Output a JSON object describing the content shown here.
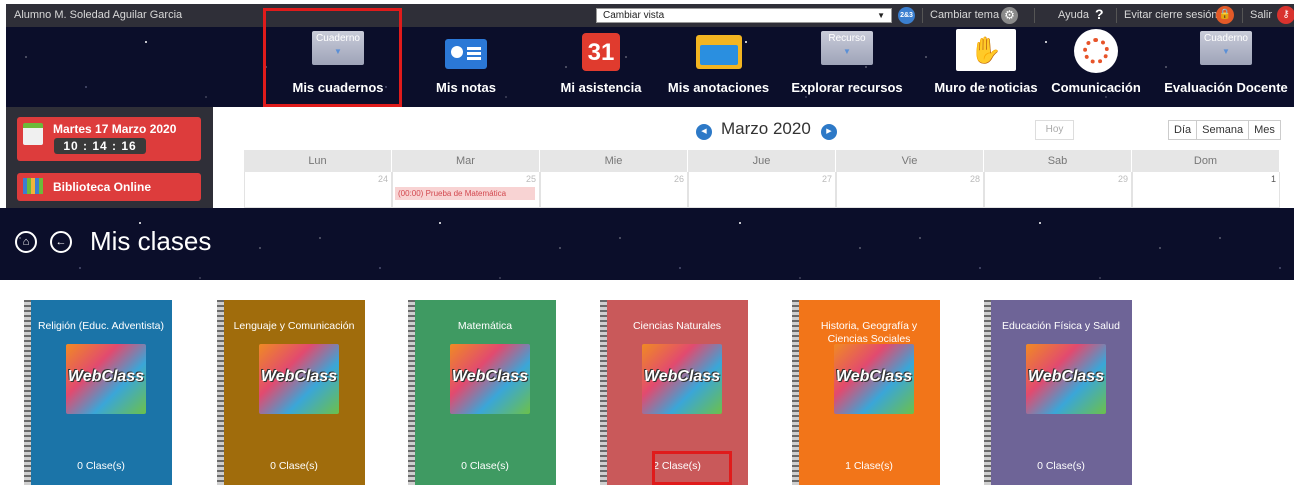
{
  "topbar": {
    "user_name": "Alumno M. Soledad Aguilar Garcia",
    "view_select_value": "Cambiar vista",
    "view_icon_text": "2&3",
    "change_theme": "Cambiar tema",
    "help": "Ayuda",
    "help_mark": "?",
    "avoid_close": "Evitar cierre sesión",
    "exit": "Salir"
  },
  "nav": {
    "items": [
      {
        "label": "Mis cuadernos",
        "icon_text": "Cuaderno"
      },
      {
        "label": "Mis notas"
      },
      {
        "label": "Mi asistencia",
        "icon_text": "31"
      },
      {
        "label": "Mis anotaciones"
      },
      {
        "label": "Explorar recursos",
        "icon_text": "Recurso"
      },
      {
        "label": "Muro de noticias"
      },
      {
        "label": "Comunicación"
      },
      {
        "label": "Evaluación Docente",
        "icon_text": "Cuaderno"
      }
    ]
  },
  "sidebar": {
    "date": "Martes 17 Marzo 2020",
    "time": "10 : 14 : 16",
    "library": "Biblioteca Online"
  },
  "calendar": {
    "title": "Marzo 2020",
    "today": "Hoy",
    "views": [
      "Día",
      "Semana",
      "Mes"
    ],
    "weekdays": [
      "Lun",
      "Mar",
      "Mie",
      "Jue",
      "Vie",
      "Sab",
      "Dom"
    ],
    "days": [
      "24",
      "25",
      "26",
      "27",
      "28",
      "29",
      "1"
    ],
    "event": "(00:00) Prueba de Matemática"
  },
  "clases": {
    "title": "Mis clases",
    "logo_text": "WebClass",
    "cards": [
      {
        "title": "Religión (Educ. Adventista)",
        "count": "0 Clase(s)",
        "color": "#1b74a8"
      },
      {
        "title": "Lenguaje y Comunicación",
        "count": "0 Clase(s)",
        "color": "#a06c0c"
      },
      {
        "title": "Matemática",
        "count": "0 Clase(s)",
        "color": "#3f9a62"
      },
      {
        "title": "Ciencias Naturales",
        "count": "2 Clase(s)",
        "color": "#c9595a"
      },
      {
        "title": "Historia, Geografía y Ciencias Sociales",
        "count": "1 Clase(s)",
        "color": "#f27519"
      },
      {
        "title": "Educación Física y Salud",
        "count": "0 Clase(s)",
        "color": "#6e6497"
      }
    ]
  }
}
